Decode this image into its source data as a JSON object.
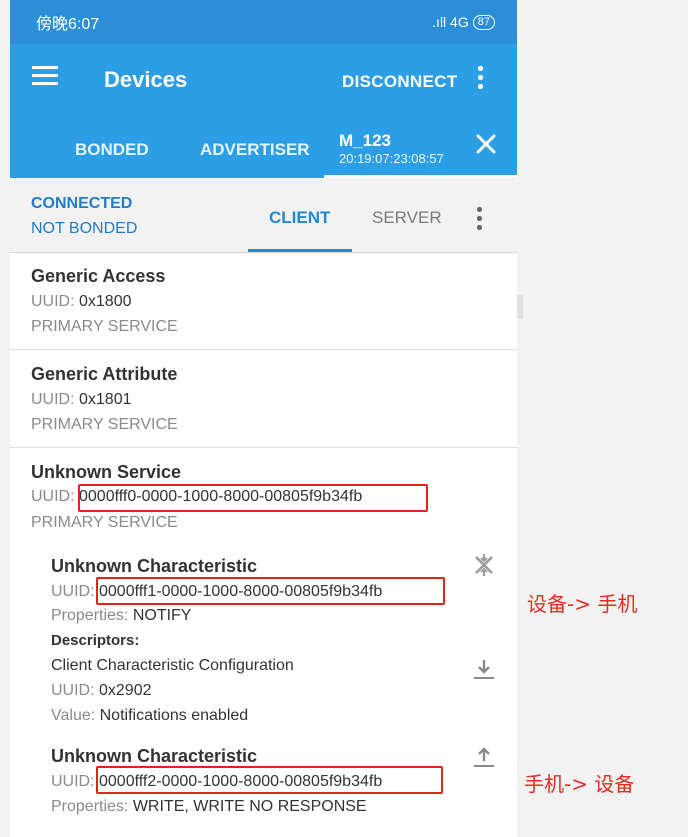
{
  "status_bar": {
    "time": "傍晚6:07",
    "signal": ".ıll 4G",
    "battery": "87"
  },
  "app_bar": {
    "title": "Devices",
    "disconnect_label": "DISCONNECT"
  },
  "tabs": {
    "bonded": "BONDED",
    "advertiser": "ADVERTISER",
    "device_name": "M_123",
    "device_address": "20:19:07:23:08:57"
  },
  "connection": {
    "state": "CONNECTED",
    "bond_state": "NOT BONDED"
  },
  "sub_tabs": {
    "client": "CLIENT",
    "server": "SERVER"
  },
  "labels": {
    "uuid_prefix": "UUID: ",
    "properties_prefix": "Properties: ",
    "descriptors": "Descriptors:",
    "value_prefix": "Value: "
  },
  "services": [
    {
      "name": "Generic Access",
      "uuid": "0x1800",
      "type": "PRIMARY SERVICE"
    },
    {
      "name": "Generic Attribute",
      "uuid": "0x1801",
      "type": "PRIMARY SERVICE"
    },
    {
      "name": "Unknown Service",
      "uuid": "0000fff0-0000-1000-8000-00805f9b34fb",
      "type": "PRIMARY SERVICE",
      "characteristics": [
        {
          "name": "Unknown Characteristic",
          "uuid": "0000fff1-0000-1000-8000-00805f9b34fb",
          "properties": "NOTIFY",
          "descriptor": {
            "name": "Client Characteristic Configuration",
            "uuid": "0x2902",
            "value": "Notifications enabled"
          }
        },
        {
          "name": "Unknown Characteristic",
          "uuid": "0000fff2-0000-1000-8000-00805f9b34fb",
          "properties": "WRITE, WRITE NO RESPONSE"
        }
      ]
    }
  ],
  "annotations": {
    "notify_note": "设备-> 手机",
    "write_note": "手机-> 设备"
  },
  "colors": {
    "status_bar": "#2c8ed6",
    "app_bar": "#2c9ee6",
    "accent": "#1f88d8",
    "annotation": "#e52d20"
  }
}
